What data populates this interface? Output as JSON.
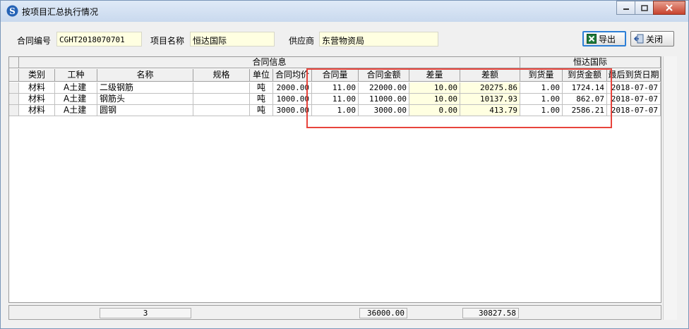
{
  "window": {
    "title": "按项目汇总执行情况"
  },
  "header": {
    "contract_no_label": "合同编号",
    "contract_no_value": "CGHT2018070701",
    "project_label": "项目名称",
    "project_value": "恒达国际",
    "supplier_label": "供应商",
    "supplier_value": "东营物资局",
    "export_label": "导出",
    "close_label": "关闭"
  },
  "table": {
    "group_contract": "合同信息",
    "group_project": "恒达国际",
    "columns": [
      "类别",
      "工种",
      "名称",
      "规格",
      "单位",
      "合同均价",
      "合同量",
      "合同金额",
      "差量",
      "差额",
      "到货量",
      "到货金额",
      "最后到货日期"
    ],
    "rows": [
      [
        "材料",
        "A土建",
        "二级钢筋",
        "",
        "吨",
        "2000.00",
        "11.00",
        "22000.00",
        "10.00",
        "20275.86",
        "1.00",
        "1724.14",
        "2018-07-07"
      ],
      [
        "材料",
        "A土建",
        "钢筋头",
        "",
        "吨",
        "1000.00",
        "11.00",
        "11000.00",
        "10.00",
        "10137.93",
        "1.00",
        "862.07",
        "2018-07-07"
      ],
      [
        "材料",
        "A土建",
        "圆钢",
        "",
        "吨",
        "3000.00",
        "1.00",
        "3000.00",
        "0.00",
        "413.79",
        "1.00",
        "2586.21",
        "2018-07-07"
      ]
    ]
  },
  "footer": {
    "row_count": "3",
    "total_amount": "36000.00",
    "total_diff": "30827.58"
  },
  "colors": {
    "highlight_box": "#e8443c",
    "field_bg": "#ffffe1",
    "titlebar": "#dfeaf7"
  }
}
